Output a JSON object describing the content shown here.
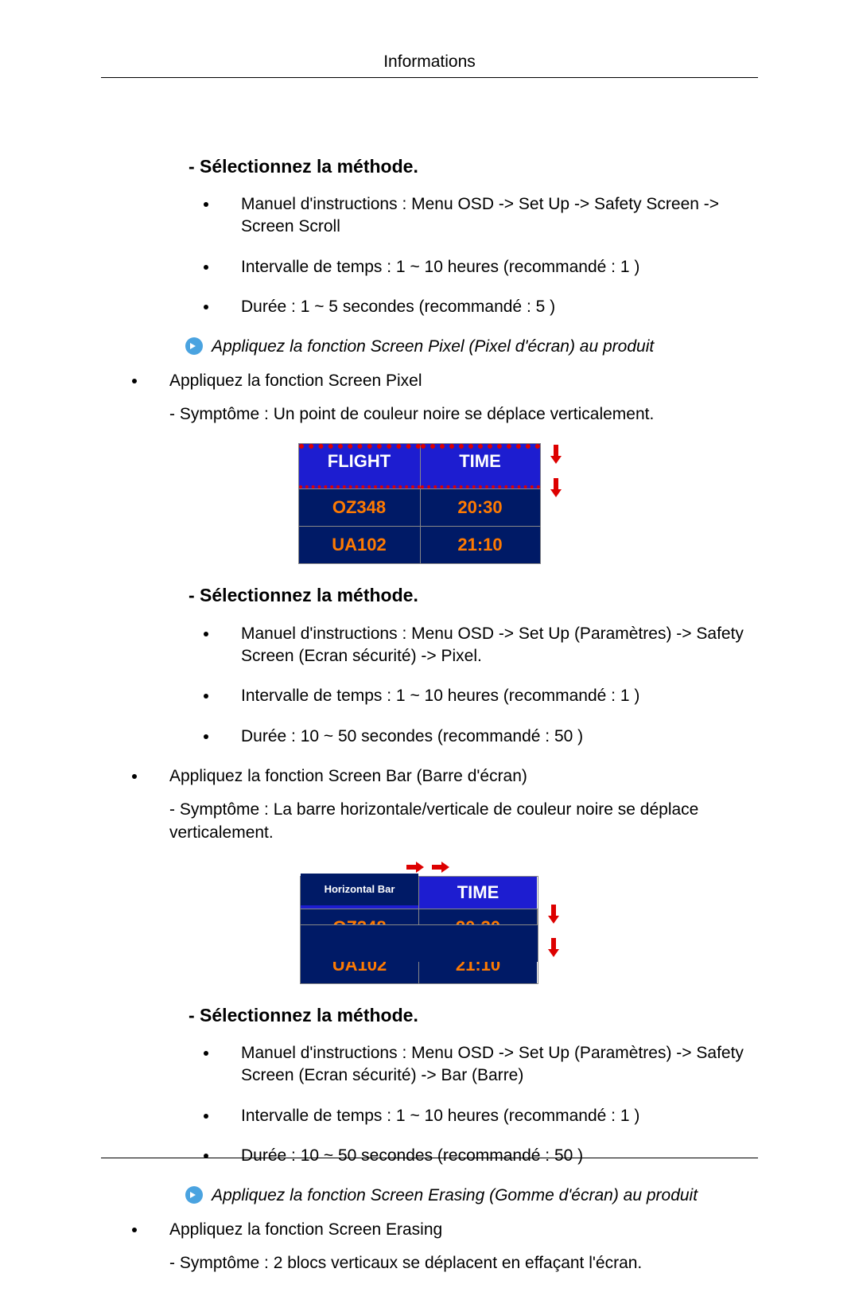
{
  "page_header": "Informations",
  "section1": {
    "title": "- Sélectionnez la méthode.",
    "items": [
      "Manuel d'instructions : Menu OSD -> Set Up -> Safety Screen -> Screen Scroll",
      "Intervalle de temps : 1 ~ 10 heures (recommandé : 1 )",
      "Durée : 1 ~ 5 secondes (recommandé : 5 )"
    ]
  },
  "note1": "Appliquez la fonction Screen Pixel (Pixel d'écran) au produit",
  "pixel_item": "Appliquez la fonction Screen Pixel",
  "pixel_symptom": "- Symptôme : Un point de couleur noire se déplace verticalement.",
  "section2": {
    "title": "- Sélectionnez la méthode.",
    "items": [
      "Manuel d'instructions : Menu OSD -> Set Up (Paramètres) -> Safety Screen (Ecran sécurité) -> Pixel.",
      "Intervalle de temps : 1 ~ 10 heures (recommandé : 1 )",
      "Durée : 10 ~ 50 secondes (recommandé : 50 )"
    ]
  },
  "bar_item": "Appliquez la fonction Screen Bar (Barre d'écran)",
  "bar_symptom": "- Symptôme : La barre horizontale/verticale de couleur noire se déplace verticalement.",
  "section3": {
    "title": "- Sélectionnez la méthode.",
    "items": [
      "Manuel d'instructions : Menu OSD -> Set Up (Paramètres) -> Safety Screen (Ecran sécurité) -> Bar (Barre)",
      "Intervalle de temps : 1 ~ 10 heures (recommandé : 1 )",
      "Durée : 10 ~ 50 secondes (recommandé : 50 )"
    ]
  },
  "note2": "Appliquez la fonction Screen Erasing (Gomme d'écran) au produit",
  "erase_item": "Appliquez la fonction Screen Erasing",
  "erase_symptom": "- Symptôme : 2 blocs verticaux se déplacent en effaçant l'écran.",
  "flight_table": {
    "h1": "FLIGHT",
    "h2": "TIME",
    "rows": [
      {
        "flight": "OZ348",
        "time": "20:30"
      },
      {
        "flight": "UA102",
        "time": "21:10"
      }
    ],
    "sublabel": "Horizontal Bar"
  }
}
